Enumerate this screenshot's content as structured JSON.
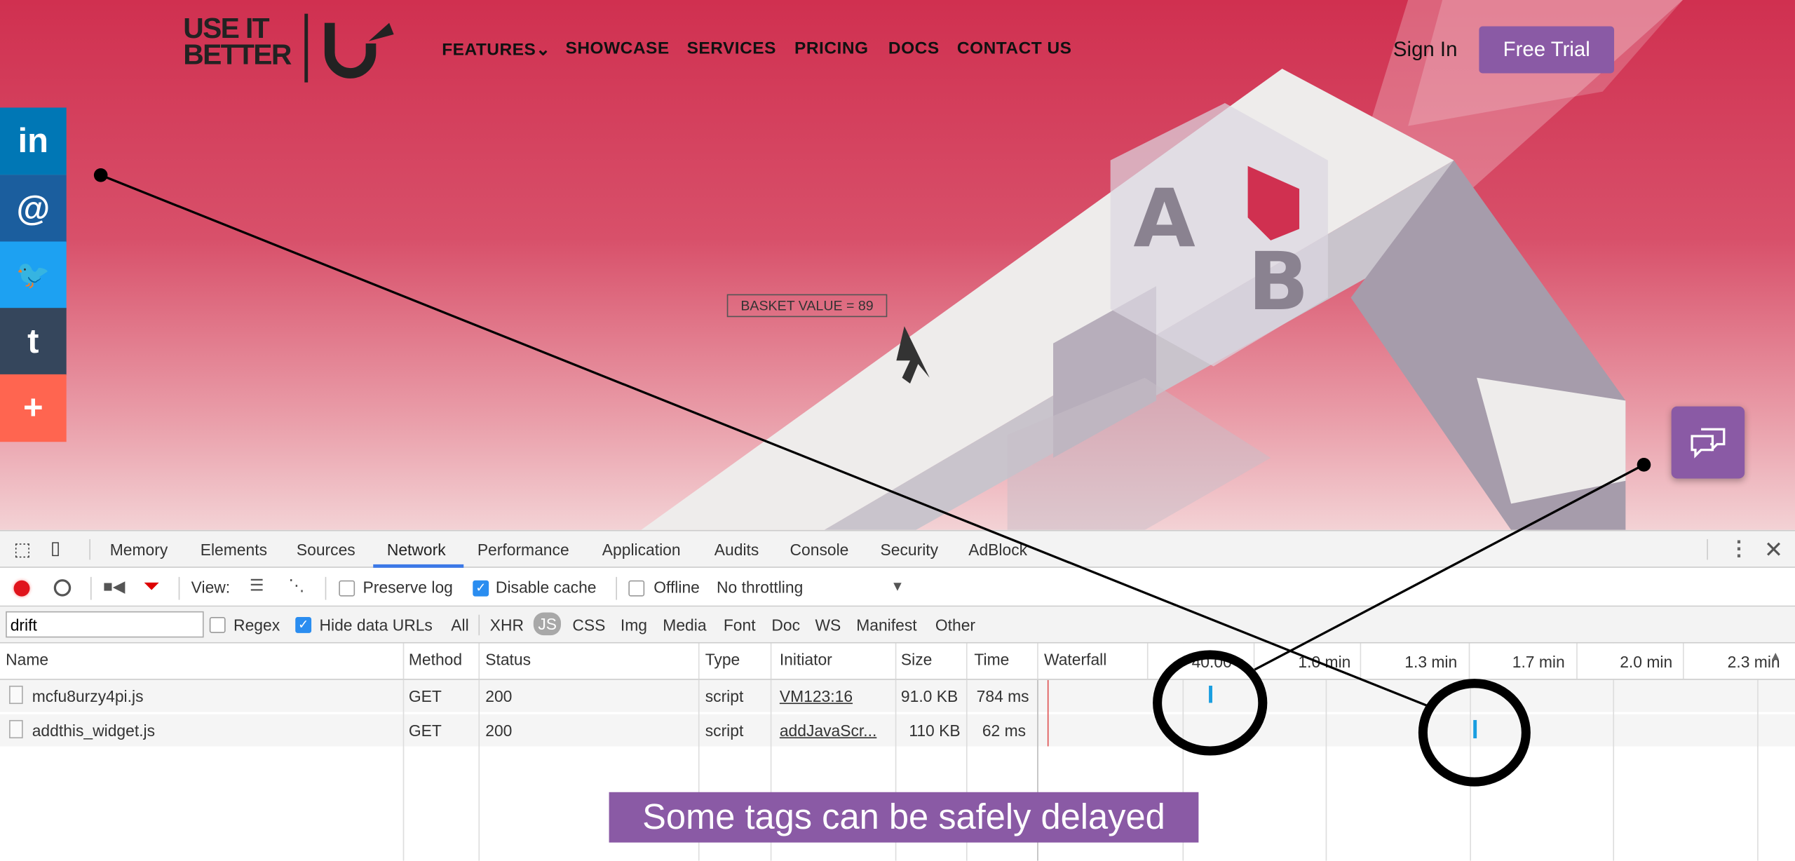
{
  "site": {
    "logo_line1": "USE IT",
    "logo_line2": "BETTER",
    "nav": [
      "FEATURES",
      "SHOWCASE",
      "SERVICES",
      "PRICING",
      "DOCS",
      "CONTACT US"
    ],
    "sign_in": "Sign In",
    "free_trial": "Free Trial",
    "basket_label": "BASKET VALUE = 89",
    "social": [
      {
        "icon": "linkedin-icon",
        "glyph": "in",
        "color": "#0077b5"
      },
      {
        "icon": "email-icon",
        "glyph": "@",
        "color": "#1b5e9e"
      },
      {
        "icon": "twitter-icon",
        "glyph": "🐦",
        "color": "#1da1f2"
      },
      {
        "icon": "tumblr-icon",
        "glyph": "t",
        "color": "#35465c"
      },
      {
        "icon": "plus-icon",
        "glyph": "+",
        "color": "#ff6550"
      }
    ],
    "brand_color": "#d03050",
    "accent": "#8a5aa5"
  },
  "devtools": {
    "tabs": [
      "Memory",
      "Elements",
      "Sources",
      "Network",
      "Performance",
      "Application",
      "Audits",
      "Console",
      "Security",
      "AdBlock"
    ],
    "active_tab": "Network",
    "toolbar": {
      "view": "View:",
      "preserve_log": "Preserve log",
      "disable_cache": "Disable cache",
      "offline": "Offline",
      "throttling": "No throttling"
    },
    "filter": {
      "value": "drift",
      "regex": "Regex",
      "hide_data_urls": "Hide data URLs",
      "types": [
        "All",
        "XHR",
        "JS",
        "CSS",
        "Img",
        "Media",
        "Font",
        "Doc",
        "WS",
        "Manifest",
        "Other"
      ],
      "active_type": "JS"
    },
    "columns": [
      "Name",
      "Method",
      "Status",
      "Type",
      "Initiator",
      "Size",
      "Time",
      "Waterfall"
    ],
    "waterfall_ticks": [
      "40.00 s",
      "1.0 min",
      "1.3 min",
      "1.7 min",
      "2.0 min",
      "2.3 min"
    ],
    "rows": [
      {
        "name": "mcfu8urzy4pi.js",
        "method": "GET",
        "status": "200",
        "type": "script",
        "initiator": "VM123:16",
        "size": "91.0 KB",
        "time": "784 ms"
      },
      {
        "name": "addthis_widget.js",
        "method": "GET",
        "status": "200",
        "type": "script",
        "initiator": "addJavaScr...",
        "size": "110 KB",
        "time": "62 ms"
      }
    ]
  },
  "caption": "Some tags can be safely delayed"
}
